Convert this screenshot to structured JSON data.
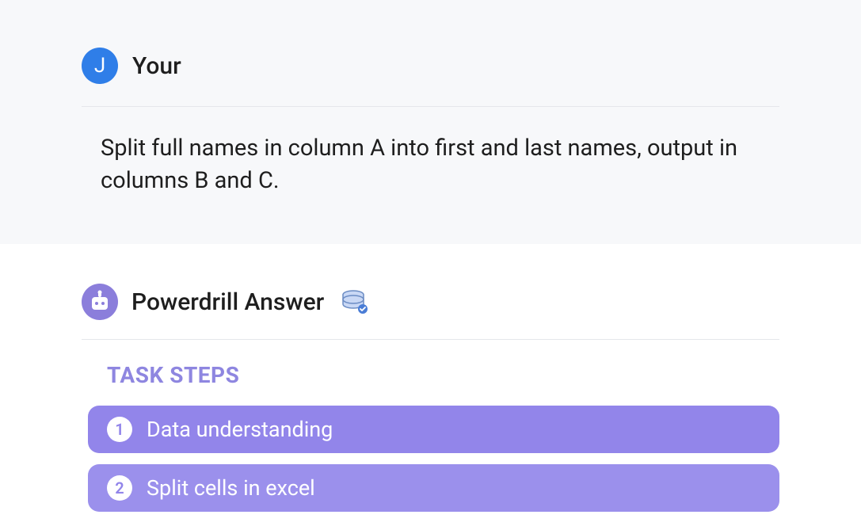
{
  "user": {
    "avatar_initial": "J",
    "name": "Your",
    "prompt": "Split full names in column A into first and last names, output in columns B and C."
  },
  "answer": {
    "title": "Powerdrill Answer",
    "task_steps_label": "TASK STEPS",
    "steps": [
      {
        "number": "1",
        "label": "Data understanding"
      },
      {
        "number": "2",
        "label": "Split cells in excel"
      }
    ]
  }
}
